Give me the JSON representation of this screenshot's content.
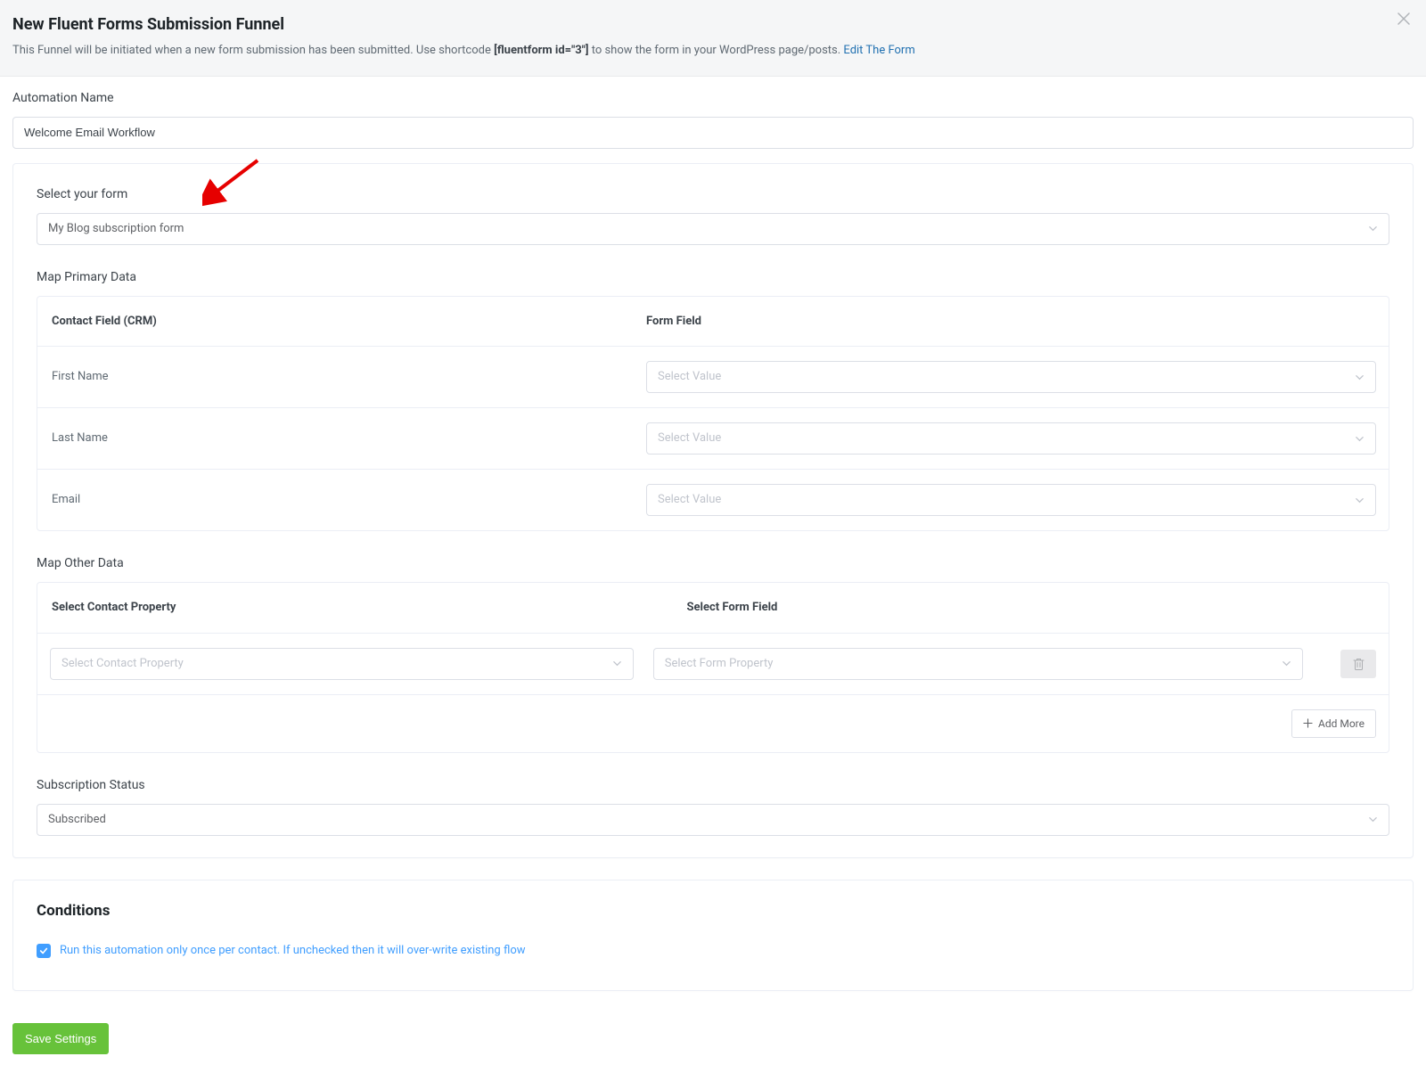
{
  "header": {
    "title": "New Fluent Forms Submission Funnel",
    "desc_pre": "This Funnel will be initiated when a new form submission has been submitted. Use shortcode ",
    "desc_code": "[fluentform id=\"3\"]",
    "desc_post": " to show the form in your WordPress page/posts. ",
    "edit_link": "Edit The Form"
  },
  "automation_name": {
    "label": "Automation Name",
    "value": "Welcome Email Workflow"
  },
  "form_select": {
    "label": "Select your form",
    "value": "My Blog subscription form"
  },
  "map_primary": {
    "title": "Map Primary Data",
    "col_contact": "Contact Field (CRM)",
    "col_form": "Form Field",
    "rows": [
      {
        "contact": "First Name",
        "form_placeholder": "Select Value"
      },
      {
        "contact": "Last Name",
        "form_placeholder": "Select Value"
      },
      {
        "contact": "Email",
        "form_placeholder": "Select Value"
      }
    ]
  },
  "map_other": {
    "title": "Map Other Data",
    "col_contact": "Select Contact Property",
    "col_form": "Select Form Field",
    "row": {
      "contact_placeholder": "Select Contact Property",
      "form_placeholder": "Select Form Property"
    },
    "add_more_label": "Add More"
  },
  "subscription_status": {
    "label": "Subscription Status",
    "value": "Subscribed"
  },
  "conditions": {
    "title": "Conditions",
    "run_once_label": "Run this automation only once per contact. If unchecked then it will over-write existing flow",
    "run_once_checked": true
  },
  "footer": {
    "save_label": "Save Settings"
  }
}
